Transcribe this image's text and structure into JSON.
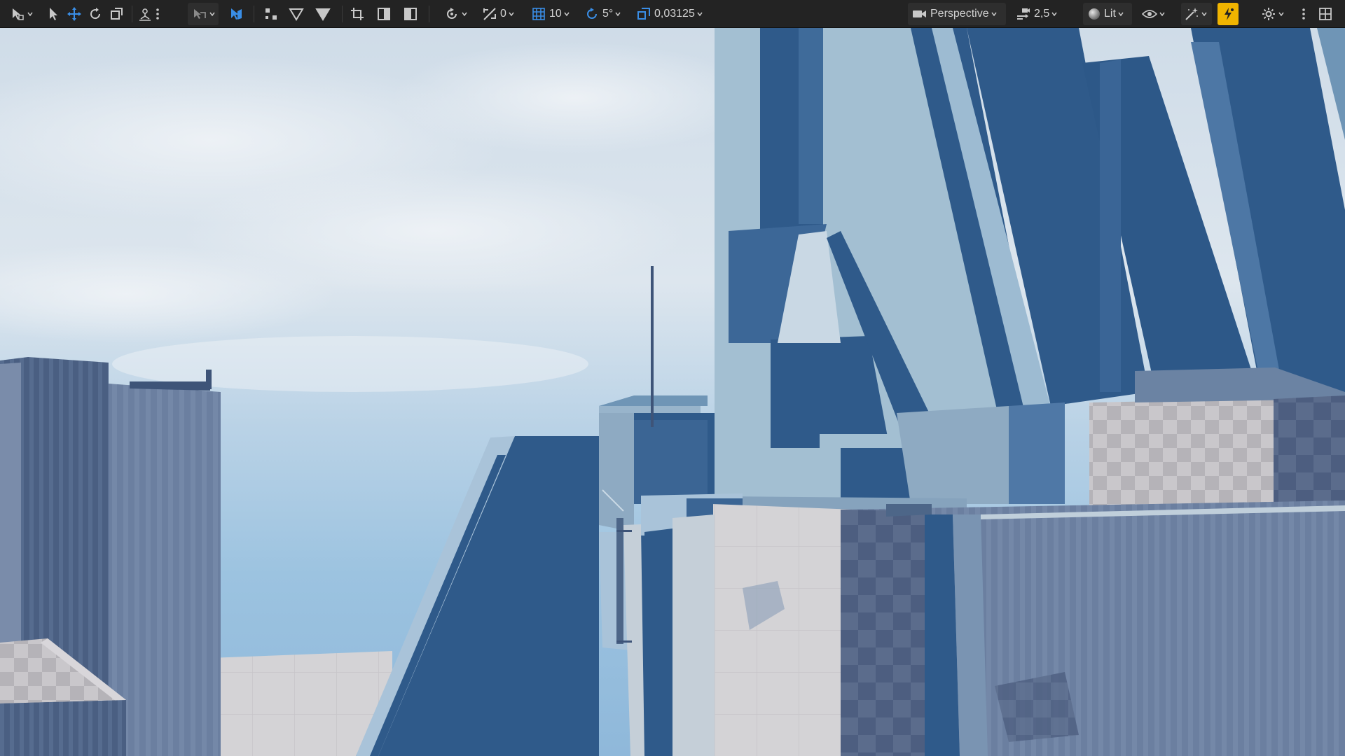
{
  "toolbar": {
    "snap_move_value": "0",
    "grid_snap_value": "10",
    "rotation_snap_value": "5°",
    "scale_snap_value": "0,03125",
    "view_mode_label": "Perspective",
    "camera_speed_value": "2,5",
    "lighting_mode_label": "Lit",
    "colors": {
      "toolbar_bg": "#232323",
      "icon": "#c8c8c8",
      "accent_blue": "#3a8ee6",
      "active_yellow": "#f0b400"
    }
  },
  "viewport": {
    "description_icons": [
      "sky",
      "buildings"
    ]
  }
}
